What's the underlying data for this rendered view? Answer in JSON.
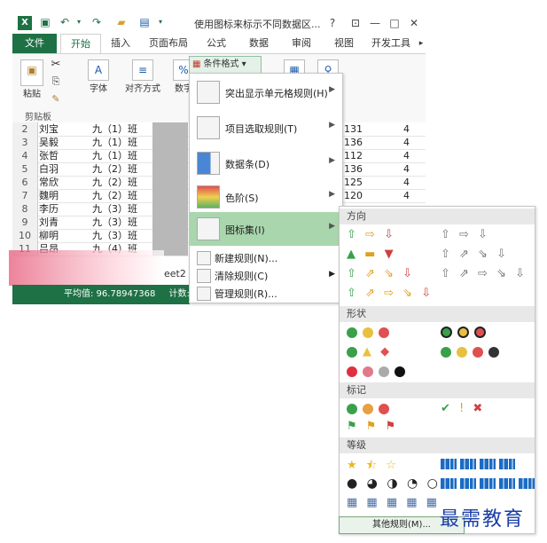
{
  "window": {
    "title": "使用图标来标示不同数据区...",
    "help": "?",
    "restore": "⊡",
    "minimize": "—",
    "maximize": "□",
    "close": "✕"
  },
  "tabs": [
    "文件",
    "开始",
    "插入",
    "页面布局",
    "公式",
    "数据",
    "审阅",
    "视图",
    "开发工具"
  ],
  "ribbon": {
    "paste": "粘贴",
    "font": "字体",
    "align": "对齐方式",
    "number": "数字",
    "clipboard": "剪贴板",
    "cond_format": "条件格式"
  },
  "sheet": {
    "rows": [
      {
        "n": "2",
        "name": "刘宝",
        "cls": "九（1）班"
      },
      {
        "n": "3",
        "name": "吴毅",
        "cls": "九（1）班"
      },
      {
        "n": "4",
        "name": "张哲",
        "cls": "九（1）班"
      },
      {
        "n": "5",
        "name": "白羽",
        "cls": "九（2）班"
      },
      {
        "n": "6",
        "name": "常欣",
        "cls": "九（2）班"
      },
      {
        "n": "7",
        "name": "魏明",
        "cls": "九（2）班"
      },
      {
        "n": "8",
        "name": "李历",
        "cls": "九（3）班"
      },
      {
        "n": "9",
        "name": "刘青",
        "cls": "九（3）班"
      },
      {
        "n": "10",
        "name": "柳明",
        "cls": "九（3）班"
      },
      {
        "n": "11",
        "name": "吕昂",
        "cls": "九（4）班"
      }
    ],
    "right_vals": [
      "131",
      "136",
      "112",
      "136",
      "125",
      "120"
    ],
    "right_col": [
      "4",
      "4",
      "4",
      "4",
      "4",
      "4"
    ],
    "sheet_tab": "eet2",
    "status_avg": "平均值: 96.78947368",
    "status_count": "计数:"
  },
  "menu": {
    "items": [
      {
        "label": "突出显示单元格规则(H)"
      },
      {
        "label": "项目选取规则(T)"
      },
      {
        "label": "数据条(D)"
      },
      {
        "label": "色阶(S)"
      },
      {
        "label": "图标集(I)"
      }
    ],
    "small": [
      {
        "label": "新建规则(N)..."
      },
      {
        "label": "清除规则(C)"
      },
      {
        "label": "管理规则(R)..."
      }
    ]
  },
  "submenu": {
    "sections": [
      "方向",
      "形状",
      "标记",
      "等级"
    ],
    "direction_rows": [
      "⇧ ⇨ ⇩",
      "▲ ▬ ▼",
      "⇧ ⇗ ⇘ ⇩",
      "⇧ ⇗ ⇨ ⇘ ⇩"
    ],
    "direction_rows_right": [
      "⇧ ⇨ ⇩",
      "⇧ ⇗ ⇘ ⇩",
      "⇧ ⇗ ⇨ ⇘ ⇩"
    ],
    "marks": [
      "✔ ! ✖",
      "⚑ ⚑ ⚑"
    ],
    "more_rules": "其他规则(M)..."
  },
  "watermark": "最需教育",
  "colors": {
    "excel_green": "#1e7145",
    "highlight": "#a9d6ad"
  }
}
